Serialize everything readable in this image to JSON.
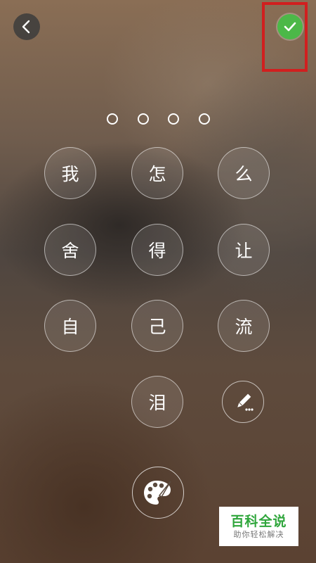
{
  "toolbar": {
    "back_icon": "chevron-left-icon",
    "confirm_icon": "check-circle-icon",
    "confirm_color": "#4cb848",
    "highlight_color": "#d11f1f"
  },
  "password": {
    "length": 4,
    "entered": 0
  },
  "keypad": {
    "keys": [
      "我",
      "怎",
      "么",
      "舍",
      "得",
      "让",
      "自",
      "己",
      "流",
      "泪"
    ],
    "edit_icon": "pencil-icon",
    "theme_icon": "palette-icon"
  },
  "watermark": {
    "title": "百科全说",
    "subtitle": "助你轻松解决"
  }
}
